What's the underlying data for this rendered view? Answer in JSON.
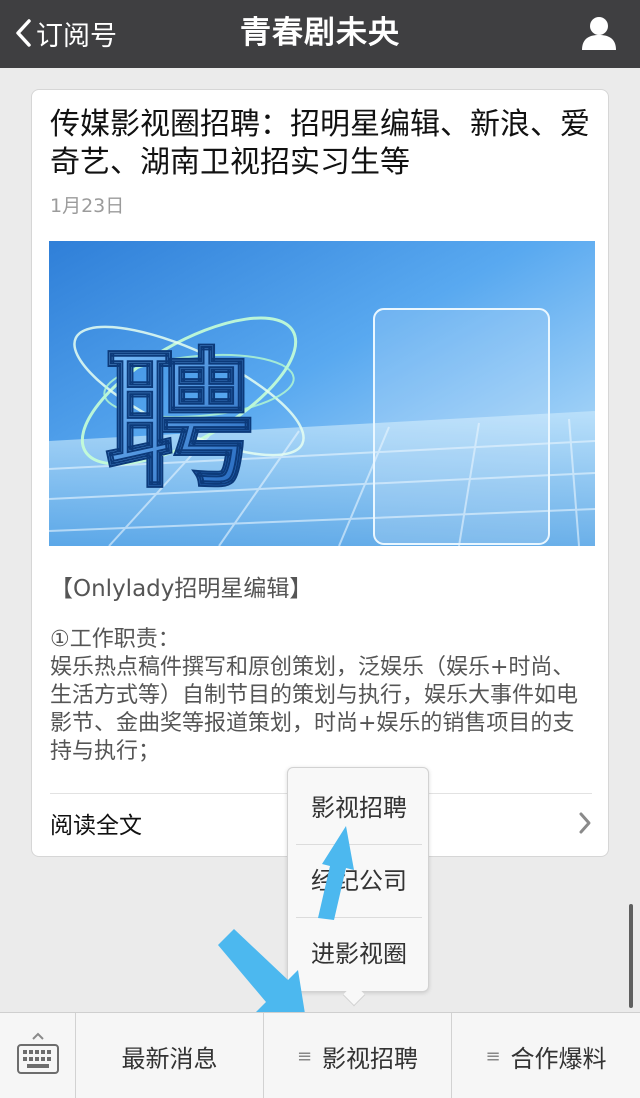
{
  "nav": {
    "back_label": "订阅号",
    "title": "青春剧未央"
  },
  "article": {
    "title": "传媒影视圈招聘：招明星编辑、新浪、爱奇艺、湖南卫视招实习生等",
    "date": "1月23日",
    "image_text": "聘",
    "section_heading": "【Onlylady招明星编辑】",
    "body": "①工作职责：\n娱乐热点稿件撰写和原创策划，泛娱乐（娱乐+时尚、生活方式等）自制节目的策划与执行，娱乐大事件如电影节、金曲奖等报道策划，时尚+娱乐的销售项目的支持与执行；",
    "read_more": "阅读全文"
  },
  "popup_menu": {
    "items": [
      "影视招聘",
      "经纪公司",
      "进影视圈"
    ]
  },
  "bottom_menu": {
    "tabs": [
      {
        "label": "最新消息",
        "has_submenu": false
      },
      {
        "label": "影视招聘",
        "has_submenu": true
      },
      {
        "label": "合作爆料",
        "has_submenu": true
      }
    ]
  },
  "icons": {
    "back": "chevron-left-icon",
    "user": "user-icon",
    "keyboard": "keyboard-icon",
    "chevron": "chevron-right-icon",
    "submenu": "menu-lines-icon"
  },
  "colors": {
    "navbar_bg": "#3f3f41",
    "annotation_arrow": "#4cb8ef"
  }
}
